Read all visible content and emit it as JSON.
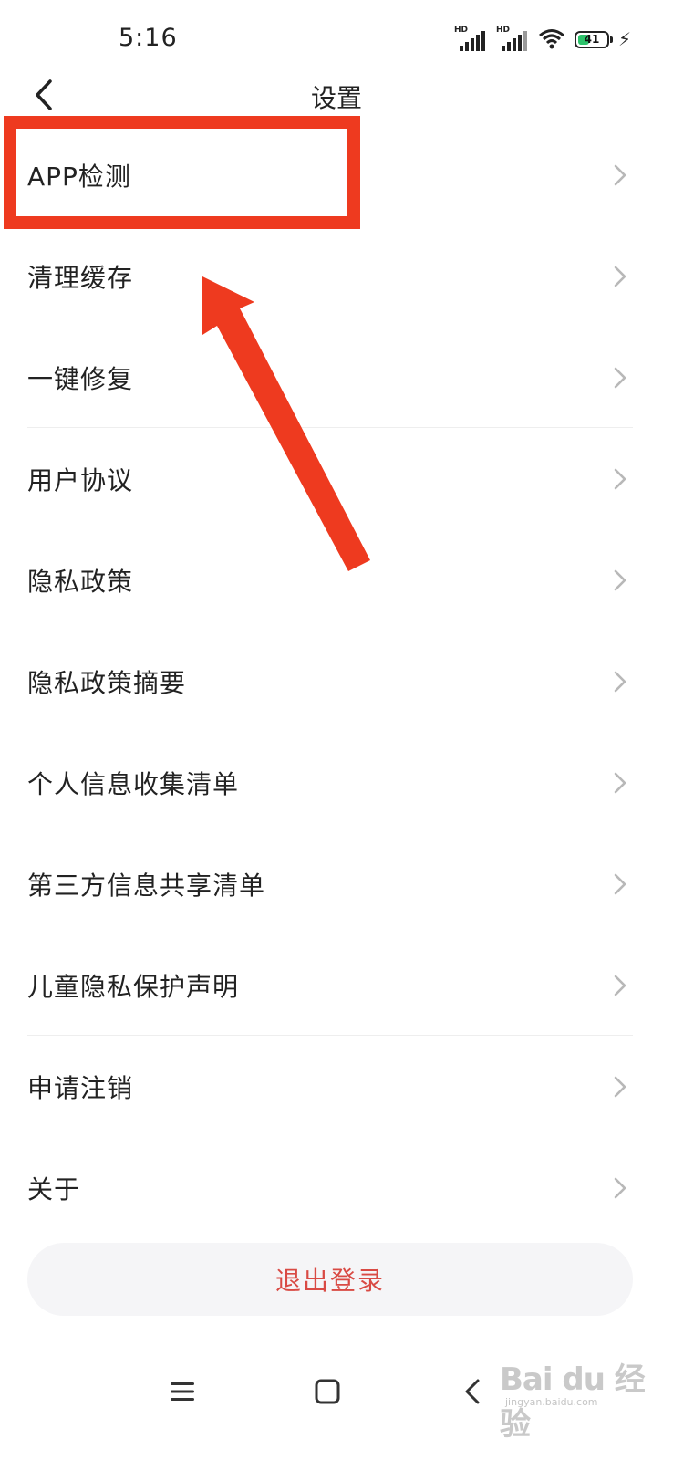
{
  "status_bar": {
    "time": "5:16",
    "signal_1_label": "HD",
    "signal_2_label": "HD",
    "battery_level": "41",
    "battery_percent": 41,
    "battery_color": "#2cc26a"
  },
  "header": {
    "title": "设置",
    "back_icon": "chevron-left-icon"
  },
  "menu": {
    "items": [
      {
        "label": "APP检测"
      },
      {
        "label": "清理缓存"
      },
      {
        "label": "一键修复"
      },
      {
        "label": "用户协议"
      },
      {
        "label": "隐私政策"
      },
      {
        "label": "隐私政策摘要"
      },
      {
        "label": "个人信息收集清单"
      },
      {
        "label": "第三方信息共享清单"
      },
      {
        "label": "儿童隐私保护声明"
      },
      {
        "label": "申请注销"
      },
      {
        "label": "关于"
      }
    ],
    "chevron_icon": "chevron-right-icon"
  },
  "logout": {
    "label": "退出登录",
    "color": "#d94a44"
  },
  "nav_bar": {
    "icons": [
      "menu-icon",
      "home-square-icon",
      "back-chevron-icon"
    ]
  },
  "annotation": {
    "highlight_color": "#ee3a1f"
  },
  "watermark": {
    "text": "Bai  du 经验",
    "url_text": "jingyan.baidu.com"
  }
}
